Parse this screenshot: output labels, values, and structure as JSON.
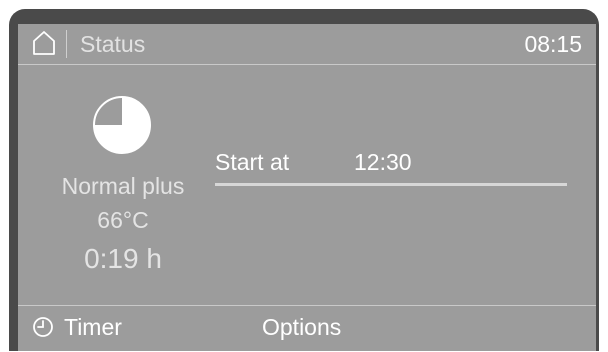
{
  "header": {
    "title": "Status",
    "time": "08:15",
    "home_icon": "home-icon"
  },
  "program": {
    "icon": "program-pie-icon",
    "progress_fraction": 0.75,
    "name": "Normal plus",
    "temperature": "66°C",
    "duration": "0:19 h"
  },
  "start": {
    "label": "Start at",
    "time": "12:30"
  },
  "footer": {
    "timer_label": "Timer",
    "timer_icon": "clock-icon",
    "options_label": "Options"
  },
  "colors": {
    "bezel": "#4a4a4a",
    "screen": "#9c9c9c",
    "text": "#ffffff",
    "muted_text": "#e4e4e4"
  }
}
